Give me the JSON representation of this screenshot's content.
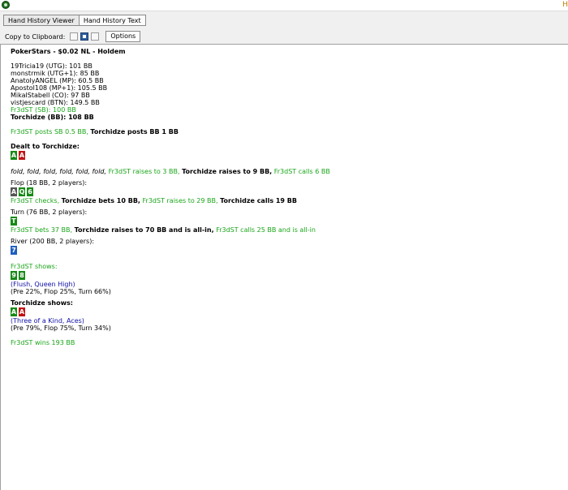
{
  "window": {
    "title_right": "H"
  },
  "tabs": [
    {
      "label": "Hand History Viewer",
      "active": true
    },
    {
      "label": "Hand History Text",
      "active": false
    }
  ],
  "toolbar": {
    "copy_label": "Copy to Clipboard:",
    "options_label": "Options"
  },
  "hand": {
    "header": "PokerStars - $0.02 NL - Holdem",
    "seats": [
      "19Tricia19 (UTG): 101 BB",
      "monstrmik (UTG+1): 85 BB",
      "AnatolyANGEL (MP): 60.5 BB",
      "Apostol108 (MP+1): 105.5 BB",
      "MikalStabell (CO): 97 BB",
      "vistjescard (BTN): 149.5 BB",
      "Fr3dST (SB): 100 BB",
      "Torchidze (BB): 108 BB"
    ],
    "blinds": {
      "sb": "Fr3dST posts SB 0.5 BB,",
      "bb": "Torchidze posts BB 1 BB"
    },
    "dealt_label": "Dealt to Torchidze:",
    "dealt_cards": [
      {
        "rank": "A",
        "suit": "clubs"
      },
      {
        "rank": "A",
        "suit": "hearts"
      }
    ],
    "preflop": {
      "folds": "fold, fold, fold, fold, fold, fold,",
      "raise1": "Fr3dST raises to 3 BB,",
      "raise2": "Torchidze raises to 9 BB,",
      "call": "Fr3dST calls 6 BB"
    },
    "flop": {
      "label": "Flop (18 BB, 2 players):",
      "cards": [
        {
          "rank": "A",
          "suit": "spades"
        },
        {
          "rank": "Q",
          "suit": "clubs"
        },
        {
          "rank": "6",
          "suit": "clubs"
        }
      ],
      "a1": "Fr3dST checks,",
      "a2": "Torchidze bets 10 BB,",
      "a3": "Fr3dST raises to 29 BB,",
      "a4": "Torchidze calls 19 BB"
    },
    "turn": {
      "label": "Turn (76 BB, 2 players):",
      "cards": [
        {
          "rank": "T",
          "suit": "clubs"
        }
      ],
      "a1": "Fr3dST bets 37 BB,",
      "a2": "Torchidze raises to 70 BB and is all-in,",
      "a3": "Fr3dST calls 25 BB and is all-in"
    },
    "river": {
      "label": "River (200 BB, 2 players):",
      "cards": [
        {
          "rank": "7",
          "suit": "diamonds"
        }
      ]
    },
    "showdown1": {
      "label": "Fr3dST shows:",
      "cards": [
        {
          "rank": "9",
          "suit": "clubs"
        },
        {
          "rank": "8",
          "suit": "clubs"
        }
      ],
      "hand": "(Flush, Queen High)",
      "equity": "(Pre 22%, Flop 25%, Turn 66%)"
    },
    "showdown2": {
      "label": "Torchidze shows:",
      "cards": [
        {
          "rank": "A",
          "suit": "clubs"
        },
        {
          "rank": "A",
          "suit": "hearts"
        }
      ],
      "hand": "(Three of a Kind, Aces)",
      "equity": "(Pre 79%, Flop 75%, Turn 34%)"
    },
    "result": "Fr3dST wins 193 BB"
  }
}
